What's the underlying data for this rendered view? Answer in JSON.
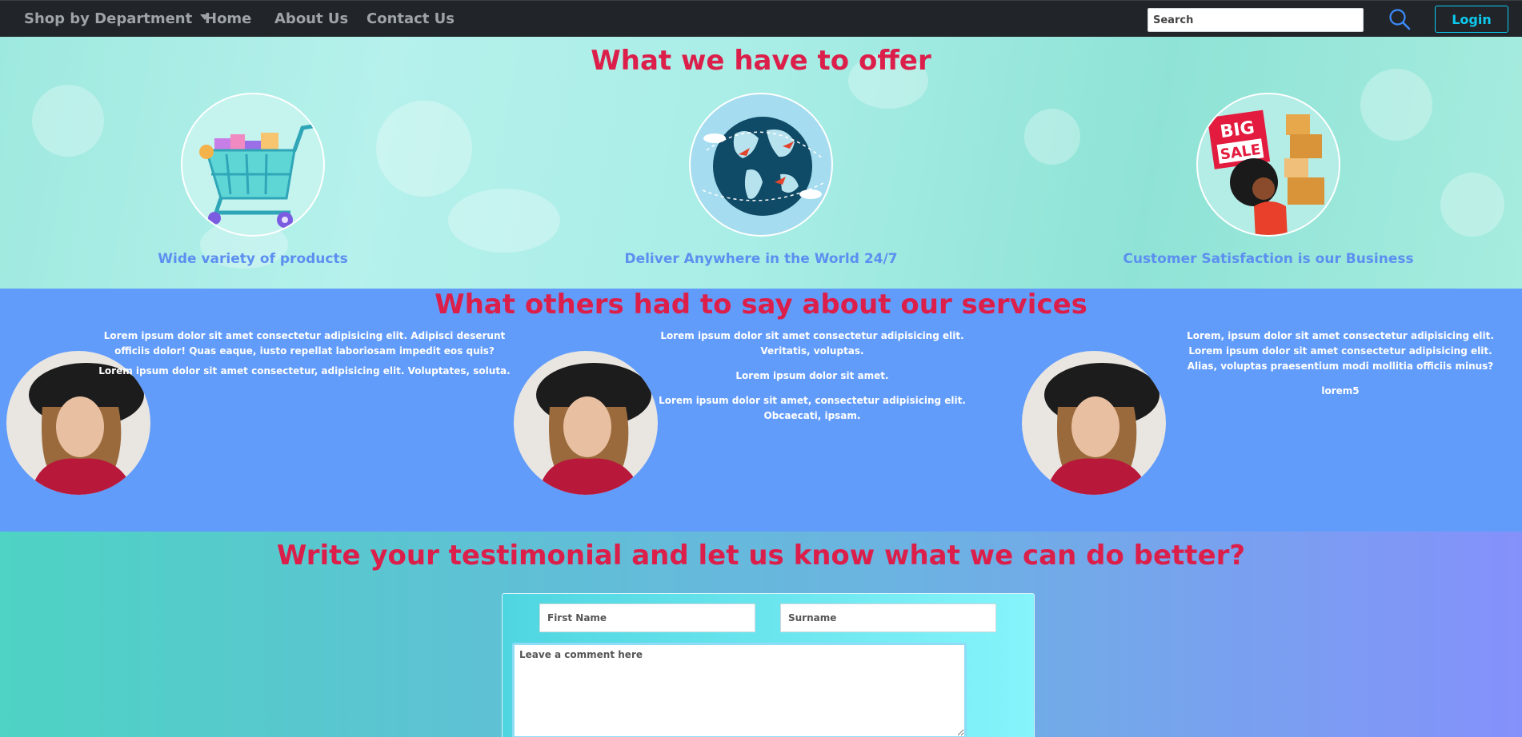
{
  "nav": {
    "dept_label": "Shop by Department",
    "home_label": "Home",
    "about_label": "About Us",
    "contact_label": "Contact Us",
    "search_placeholder": "Search",
    "login_label": "Login"
  },
  "offer": {
    "title": "What we have to offer",
    "items": [
      {
        "label": "Wide variety of products",
        "icon": "shopping-cart-icon"
      },
      {
        "label": "Deliver Anywhere in the World 24/7",
        "icon": "globe-planes-icon"
      },
      {
        "label": "Customer Satisfaction is our Business",
        "icon": "big-sale-woman-icon"
      }
    ],
    "sale_badge_line1": "BIG",
    "sale_badge_line2": "SALE"
  },
  "reviews": {
    "title": "What others had to say about our services",
    "items": [
      {
        "paragraphs": [
          "Lorem ipsum dolor sit amet consectetur adipisicing elit. Adipisci deserunt officiis dolor! Quas eaque, iusto repellat laboriosam impedit eos quis?",
          "Lorem ipsum dolor sit amet consectetur, adipisicing elit. Voluptates, soluta."
        ]
      },
      {
        "paragraphs": [
          "Lorem ipsum dolor sit amet consectetur adipisicing elit. Veritatis, voluptas.",
          "Lorem ipsum dolor sit amet.",
          "Lorem ipsum dolor sit amet, consectetur adipisicing elit. Obcaecati, ipsam."
        ]
      },
      {
        "paragraphs": [
          "Lorem, ipsum dolor sit amet consectetur adipisicing elit.",
          "Lorem ipsum dolor sit amet consectetur adipisicing elit. Alias, voluptas praesentium modi mollitia officiis minus?",
          "lorem5"
        ]
      }
    ]
  },
  "write": {
    "title": "Write your testimonial and let us know what we can do better?",
    "first_name_placeholder": "First Name",
    "surname_placeholder": "Surname",
    "comment_placeholder": "Leave a comment here"
  },
  "colors": {
    "navbar": "#212529",
    "heading": "#dc1f4a",
    "offer_label": "#5c8ff0",
    "reviews_bg": "#629cfa",
    "login_accent": "#0dcaf0"
  }
}
